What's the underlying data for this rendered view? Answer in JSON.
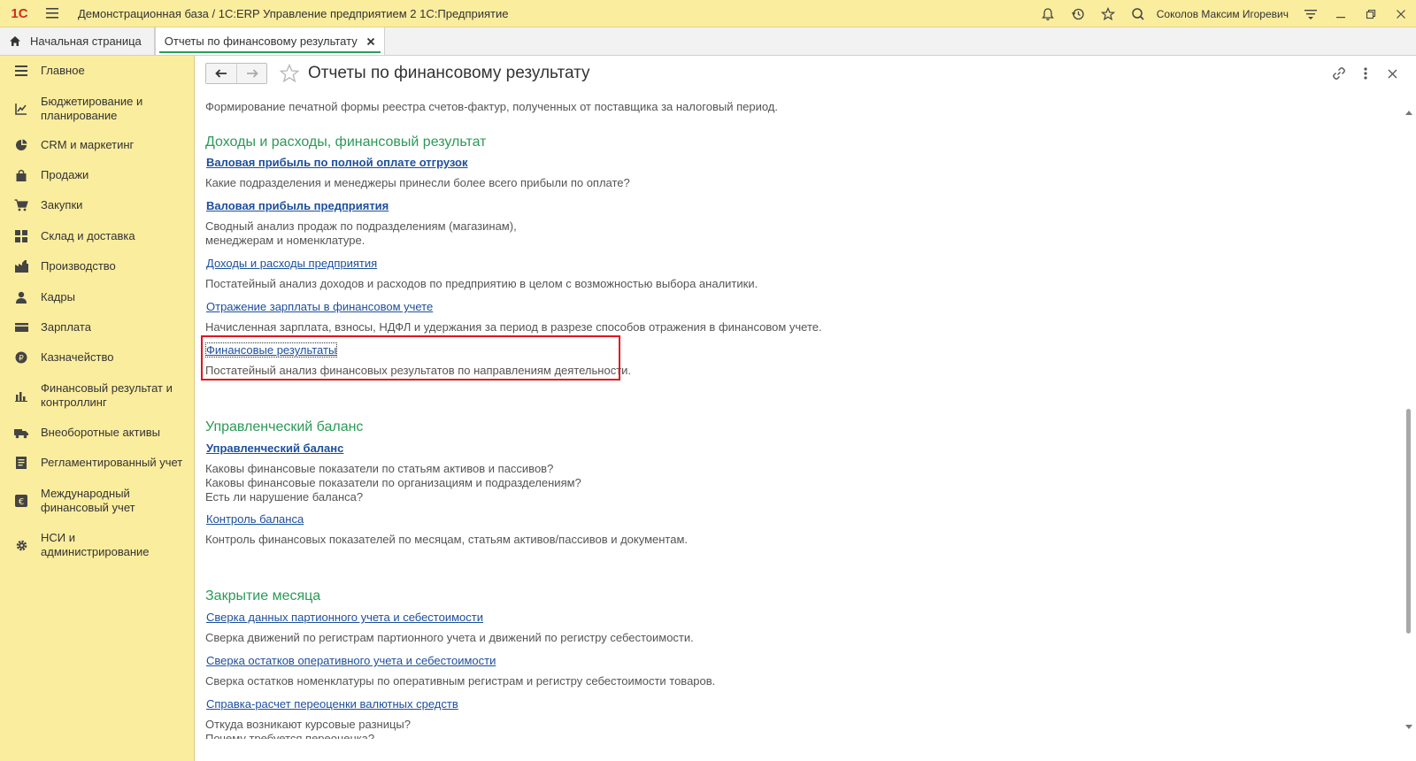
{
  "titlebar": {
    "logo": "1С",
    "app_title": "Демонстрационная база / 1С:ERP Управление предприятием 2 1С:Предприятие",
    "user_name": "Соколов Максим Игоревич",
    "icons": [
      "hamburger-icon",
      "bell-icon",
      "history-icon",
      "star-icon",
      "search-icon",
      "settings-icon",
      "minimize-icon",
      "restore-icon",
      "close-icon"
    ]
  },
  "tabs": {
    "home_label": "Начальная страница",
    "active_label": "Отчеты по финансовому результату"
  },
  "sidebar": {
    "items": [
      {
        "label": "Главное",
        "icon": "menu-icon"
      },
      {
        "label": "Бюджетирование и\nпланирование",
        "icon": "budget-icon"
      },
      {
        "label": "CRM и маркетинг",
        "icon": "crm-icon"
      },
      {
        "label": "Продажи",
        "icon": "bag-icon"
      },
      {
        "label": "Закупки",
        "icon": "cart-icon"
      },
      {
        "label": "Склад и доставка",
        "icon": "warehouse-icon"
      },
      {
        "label": "Производство",
        "icon": "factory-icon"
      },
      {
        "label": "Кадры",
        "icon": "person-icon"
      },
      {
        "label": "Зарплата",
        "icon": "wallet-icon"
      },
      {
        "label": "Казначейство",
        "icon": "coin-icon"
      },
      {
        "label": "Финансовый результат и\nконтроллинг",
        "icon": "chart-icon"
      },
      {
        "label": "Внеоборотные активы",
        "icon": "truck-icon"
      },
      {
        "label": "Регламентированный учет",
        "icon": "document-icon"
      },
      {
        "label": "Международный\nфинансовый учет",
        "icon": "euro-icon"
      },
      {
        "label": "НСИ и\nадминистрирование",
        "icon": "gear-icon"
      }
    ]
  },
  "page": {
    "title": "Отчеты по финансовому результату",
    "cut_top_text": "Формирование печатной формы реестра счетов-фактур, полученных от поставщика за налоговый период.",
    "sections": [
      {
        "title": "Доходы и расходы, финансовый результат",
        "reports": [
          {
            "name": "Валовая прибыль по полной оплате отгрузок",
            "bold": true,
            "desc": "Какие подразделения и менеджеры принесли более всего прибыли по оплате?"
          },
          {
            "name": "Валовая прибыль предприятия",
            "bold": true,
            "desc": "Сводный анализ продаж по подразделениям (магазинам),\nменеджерам и номенклатуре."
          },
          {
            "name": "Доходы и расходы предприятия",
            "bold": false,
            "desc": "Постатейный анализ доходов и расходов по предприятию в целом с возможностью выбора аналитики."
          },
          {
            "name": "Отражение зарплаты в финансовом учете",
            "bold": false,
            "desc": "Начисленная зарплата, взносы, НДФЛ и удержания за период в разрезе способов отражения в финансовом учете."
          },
          {
            "name": "Финансовые результаты",
            "bold": false,
            "desc": "Постатейный анализ финансовых результатов по направлениям деятельности."
          }
        ]
      },
      {
        "title": "Управленческий баланс",
        "reports": [
          {
            "name": "Управленческий баланс",
            "bold": true,
            "desc": "Каковы финансовые показатели по статьям активов и пассивов?\nКаковы финансовые показатели по организациям и подразделениям?\nЕсть ли нарушение баланса?"
          },
          {
            "name": "Контроль баланса",
            "bold": false,
            "desc": "Контроль финансовых показателей по месяцам, статьям активов/пассивов и документам."
          }
        ]
      },
      {
        "title": "Закрытие месяца",
        "reports": [
          {
            "name": "Сверка данных партионного учета и себестоимости",
            "bold": false,
            "desc": "Сверка движений по регистрам партионного учета и движений по регистру себестоимости."
          },
          {
            "name": "Сверка остатков оперативного учета и себестоимости",
            "bold": false,
            "desc": "Сверка остатков номенклатуры по оперативным регистрам и регистру себестоимости товаров."
          },
          {
            "name": "Справка-расчет переоценки валютных средств",
            "bold": false,
            "desc": "Откуда возникают курсовые разницы?"
          }
        ]
      }
    ],
    "cut_bottom_text": "Почему требуется переоценка?"
  },
  "colors": {
    "sidebar_bg": "#fbed9e",
    "section_title": "#2b9a57",
    "link": "#1c4f9c",
    "highlight_border": "#e0141e"
  }
}
